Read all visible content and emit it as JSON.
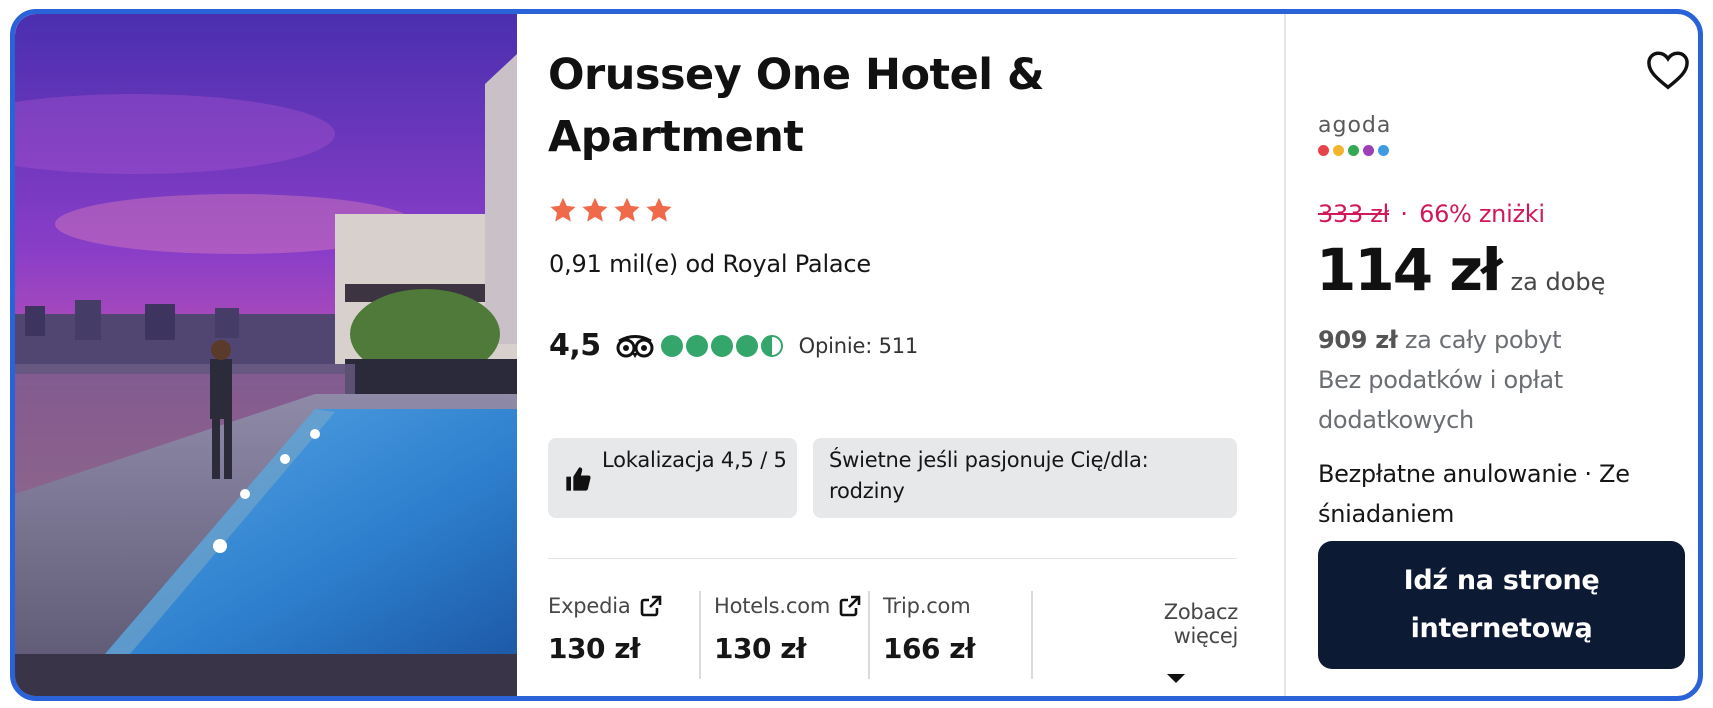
{
  "hotel": {
    "name": "Orussey One Hotel & Apartment",
    "star_count": 4,
    "distance": "0,91 mil(e) od Royal Palace",
    "rating": "4,5",
    "rating_bubbles": 4.5,
    "reviews": "Opinie: 511"
  },
  "tags": [
    {
      "text": "Lokalizacja 4,5 / 5",
      "icon": "thumbs-up-icon"
    },
    {
      "text": "Świetne jeśli pasjonuje Cię/dla: rodziny"
    }
  ],
  "providers": [
    {
      "name": "Expedia",
      "price": "130 zł",
      "icon": "external-link-icon"
    },
    {
      "name": "Hotels.com",
      "price": "130 zł",
      "icon": "external-link-icon"
    },
    {
      "name": "Trip.com",
      "price": "166 zł"
    }
  ],
  "more": {
    "label": "Zobacz więcej",
    "icon": "caret-down-icon"
  },
  "offer": {
    "provider_logo": "agoda",
    "old_price": "333 zł",
    "separator": "·",
    "discount": "66% zniżki",
    "price": "114 zł",
    "per": "za dobę",
    "total_amount": "909 zł",
    "total_label": "za cały pobyt",
    "tax_note": "Bez podatków i opłat dodatkowych",
    "perks": "Bezpłatne anulowanie · Ze śniadaniem",
    "cta": "Idź na stronę internetową"
  },
  "colors": {
    "accent_border": "#2a62d8",
    "star": "#ef6a4a",
    "bubble": "#34a66b",
    "discount": "#d1185a",
    "cta_bg": "#0c1a33",
    "agoda_dots": [
      "#e8434a",
      "#f3b52d",
      "#35a853",
      "#9b3fb5",
      "#3f9be1"
    ]
  },
  "icons": [
    "heart-icon",
    "thumbs-up-icon",
    "tripadvisor-owl-icon",
    "external-link-icon",
    "caret-down-icon",
    "star-icon"
  ]
}
